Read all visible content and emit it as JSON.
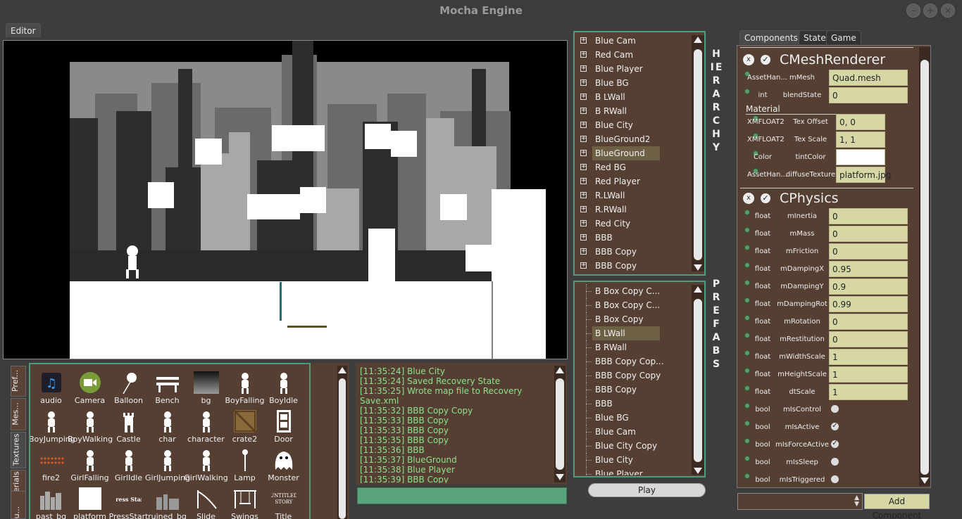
{
  "app": {
    "title": "Mocha Engine"
  },
  "window_controls": {
    "minimize": "–",
    "maximize": "+",
    "close": "×"
  },
  "editor_tab": {
    "label": "Editor"
  },
  "right_tabs": [
    "Components",
    "State",
    "Game"
  ],
  "hierarchy": {
    "label": "HIERARCHY",
    "items": [
      "Blue Cam",
      "Red Cam",
      "Blue Player",
      "Blue BG",
      "B LWall",
      "B RWall",
      "Blue City",
      "BlueGround2",
      "BlueGround",
      "Red BG",
      "Red Player",
      "R.LWall",
      "R.RWall",
      "Red City",
      "BBB",
      "BBB Copy",
      "BBB Copy"
    ],
    "selected_index": 8
  },
  "prefabs": {
    "label": "PREFABS",
    "items": [
      "B Box Copy C...",
      "B Box Copy C...",
      "B Box Copy",
      "B LWall",
      "B RWall",
      "BBB Copy Cop...",
      "BBB Copy Copy",
      "BBB Copy",
      "BBB",
      "Blue BG",
      "Blue Cam",
      "Blue City Copy",
      "Blue City",
      "Blue Player"
    ],
    "selected_index": 3
  },
  "play_button": {
    "label": "Play"
  },
  "asset_tabs": [
    "Pref...",
    "Mes...",
    "Textures",
    "Materials",
    "Sou..."
  ],
  "assets": [
    {
      "name": "audio",
      "icon": "music-note-icon"
    },
    {
      "name": "Camera",
      "icon": "video-camera-icon"
    },
    {
      "name": "Balloon",
      "icon": "balloon-icon"
    },
    {
      "name": "Bench",
      "icon": "bench-icon"
    },
    {
      "name": "bg",
      "icon": "gradient-icon"
    },
    {
      "name": "BoyFalling",
      "icon": "boy-falling-icon"
    },
    {
      "name": "BoyIdle",
      "icon": "boy-idle-icon"
    },
    {
      "name": "BoyJumping",
      "icon": "boy-jumping-icon"
    },
    {
      "name": "BoyWalking",
      "icon": "boy-walking-icon"
    },
    {
      "name": "Castle",
      "icon": "castle-icon"
    },
    {
      "name": "char",
      "icon": "char-icon"
    },
    {
      "name": "character",
      "icon": "character-icon"
    },
    {
      "name": "crate2",
      "icon": "crate-icon"
    },
    {
      "name": "Door",
      "icon": "door-icon"
    },
    {
      "name": "fire2",
      "icon": "fire-icon"
    },
    {
      "name": "GirlFalling",
      "icon": "girl-falling-icon"
    },
    {
      "name": "GirlIdle",
      "icon": "girl-idle-icon"
    },
    {
      "name": "GirlJumping",
      "icon": "girl-jumping-icon"
    },
    {
      "name": "GirlWalking",
      "icon": "girl-walking-icon"
    },
    {
      "name": "Lamp",
      "icon": "lamp-icon"
    },
    {
      "name": "Monster",
      "icon": "monster-icon"
    },
    {
      "name": "past_bg",
      "icon": "city-icon"
    },
    {
      "name": "platform",
      "icon": "white-square-icon"
    },
    {
      "name": "PressStart",
      "icon": "press-start-icon",
      "text": "Press Start"
    },
    {
      "name": "ruined_bg",
      "icon": "ruins-icon"
    },
    {
      "name": "Slide",
      "icon": "slide-icon"
    },
    {
      "name": "Swings",
      "icon": "swings-icon"
    },
    {
      "name": "Title",
      "icon": "title-icon",
      "text": "UNTITLED STORY"
    }
  ],
  "console": {
    "lines": [
      "[11:35:24] Blue City",
      "[11:35:24] Saved Recovery State",
      "[11:35:25] Wrote map file to Recovery",
      "Save.xml",
      "[11:35:32] BBB Copy Copy",
      "[11:35:33] BBB Copy",
      "[11:35:33] BBB Copy",
      "[11:35:35] BBB Copy",
      "[11:35:36] BBB",
      "[11:35:37] BlueGround",
      "[11:35:38] Blue Player",
      "[11:35:39] BBB Copy"
    ],
    "input_value": ""
  },
  "components": {
    "mesh_renderer": {
      "title": "CMeshRenderer",
      "close": "x",
      "enabled": "✓",
      "props": [
        {
          "type": "AssetHan...",
          "name": "mMesh",
          "value": "Quad.mesh"
        },
        {
          "type": "int",
          "name": "blendState",
          "value": "0"
        }
      ],
      "material_label": "Material",
      "material_props": [
        {
          "type": "XMFLOAT2",
          "name": "Tex Offset",
          "value": "0, 0"
        },
        {
          "type": "XMFLOAT2",
          "name": "Tex Scale",
          "value": "1, 1"
        },
        {
          "type": "Color",
          "name": "tintColor",
          "value": ""
        },
        {
          "type": "AssetHan...",
          "name": "diffuseTexture",
          "value": "platform.jpg"
        }
      ]
    },
    "physics": {
      "title": "CPhysics",
      "close": "x",
      "enabled": "✓",
      "props": [
        {
          "type": "float",
          "name": "mInertia",
          "value": "0"
        },
        {
          "type": "float",
          "name": "mMass",
          "value": "0"
        },
        {
          "type": "float",
          "name": "mFriction",
          "value": "0"
        },
        {
          "type": "float",
          "name": "mDampingX",
          "value": "0.95"
        },
        {
          "type": "float",
          "name": "mDampingY",
          "value": "0.9"
        },
        {
          "type": "float",
          "name": "mDampingRot",
          "value": "0.99"
        },
        {
          "type": "float",
          "name": "mRotation",
          "value": "0"
        },
        {
          "type": "float",
          "name": "mRestitution",
          "value": "0"
        },
        {
          "type": "float",
          "name": "mWidthScale",
          "value": "1"
        },
        {
          "type": "float",
          "name": "mHeightScale",
          "value": "1"
        },
        {
          "type": "float",
          "name": "dtScale",
          "value": "1"
        }
      ],
      "bool_props": [
        {
          "type": "bool",
          "name": "mIsControl",
          "checked": false
        },
        {
          "type": "bool",
          "name": "mIsActive",
          "checked": true
        },
        {
          "type": "bool",
          "name": "mIsForceActive",
          "checked": true
        },
        {
          "type": "bool",
          "name": "mIsSleep",
          "checked": false
        },
        {
          "type": "bool",
          "name": "mIsTriggered",
          "checked": false
        }
      ]
    }
  },
  "add_component": {
    "label": "Add Component",
    "select_value": ""
  },
  "colors": {
    "accent_green": "#4f9c7c",
    "panel_brown": "#553f33",
    "field_bg": "#d7d7a6",
    "console_text": "#8de08d"
  }
}
